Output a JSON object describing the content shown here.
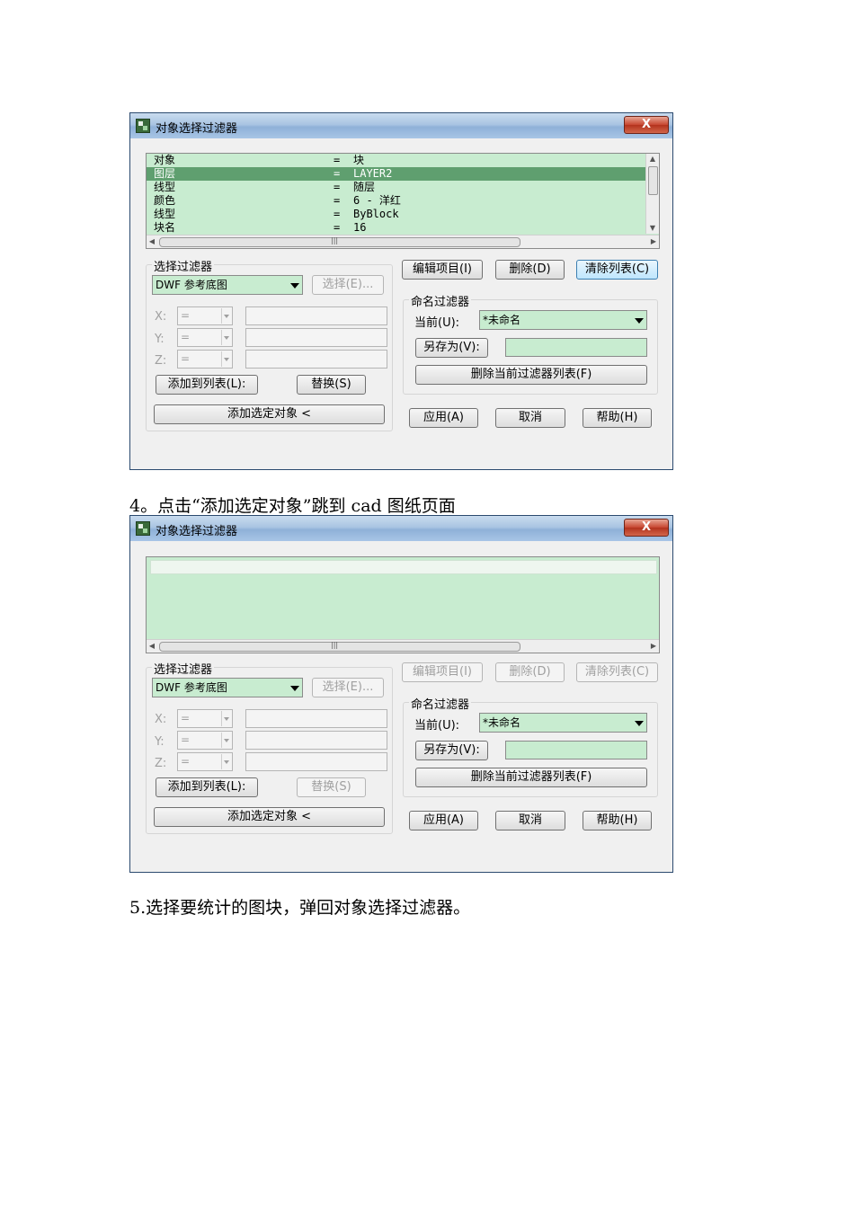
{
  "dialog_title": "对象选择过滤器",
  "close_label": "X",
  "list_rows": [
    {
      "key": "对象",
      "eq": "=",
      "val": "块",
      "selected": false
    },
    {
      "key": "图层",
      "eq": "=",
      "val": "LAYER2",
      "selected": true
    },
    {
      "key": "线型",
      "eq": "=",
      "val": "随层",
      "selected": false
    },
    {
      "key": "颜色",
      "eq": "=",
      "val": "6 - 洋红",
      "selected": false
    },
    {
      "key": "线型",
      "eq": "=",
      "val": "ByBlock",
      "selected": false
    },
    {
      "key": "块名",
      "eq": "=",
      "val": "16",
      "selected": false
    }
  ],
  "select_filter": {
    "legend": "选择过滤器",
    "combo_value": "DWF 参考底图",
    "select_button": "选择(E)...",
    "x_label": "X:",
    "y_label": "Y:",
    "z_label": "Z:",
    "op_value": "=",
    "add_to_list": "添加到列表(L):",
    "replace": "替换(S)",
    "add_selected": "添加选定对象 <"
  },
  "edit_item": "编辑项目(I)",
  "delete": "删除(D)",
  "clear_list": "清除列表(C)",
  "named_filter": {
    "legend": "命名过滤器",
    "current_label": "当前(U):",
    "current_value": "*未命名",
    "save_as": "另存为(V):",
    "delete_current": "删除当前过滤器列表(F)"
  },
  "apply": "应用(A)",
  "cancel": "取消",
  "help": "帮助(H)",
  "para_step4": "4。点击“添加选定对象”跳到 cad 图纸页面",
  "para_step5": "5.选择要统计的图块，弹回对象选择过滤器。"
}
